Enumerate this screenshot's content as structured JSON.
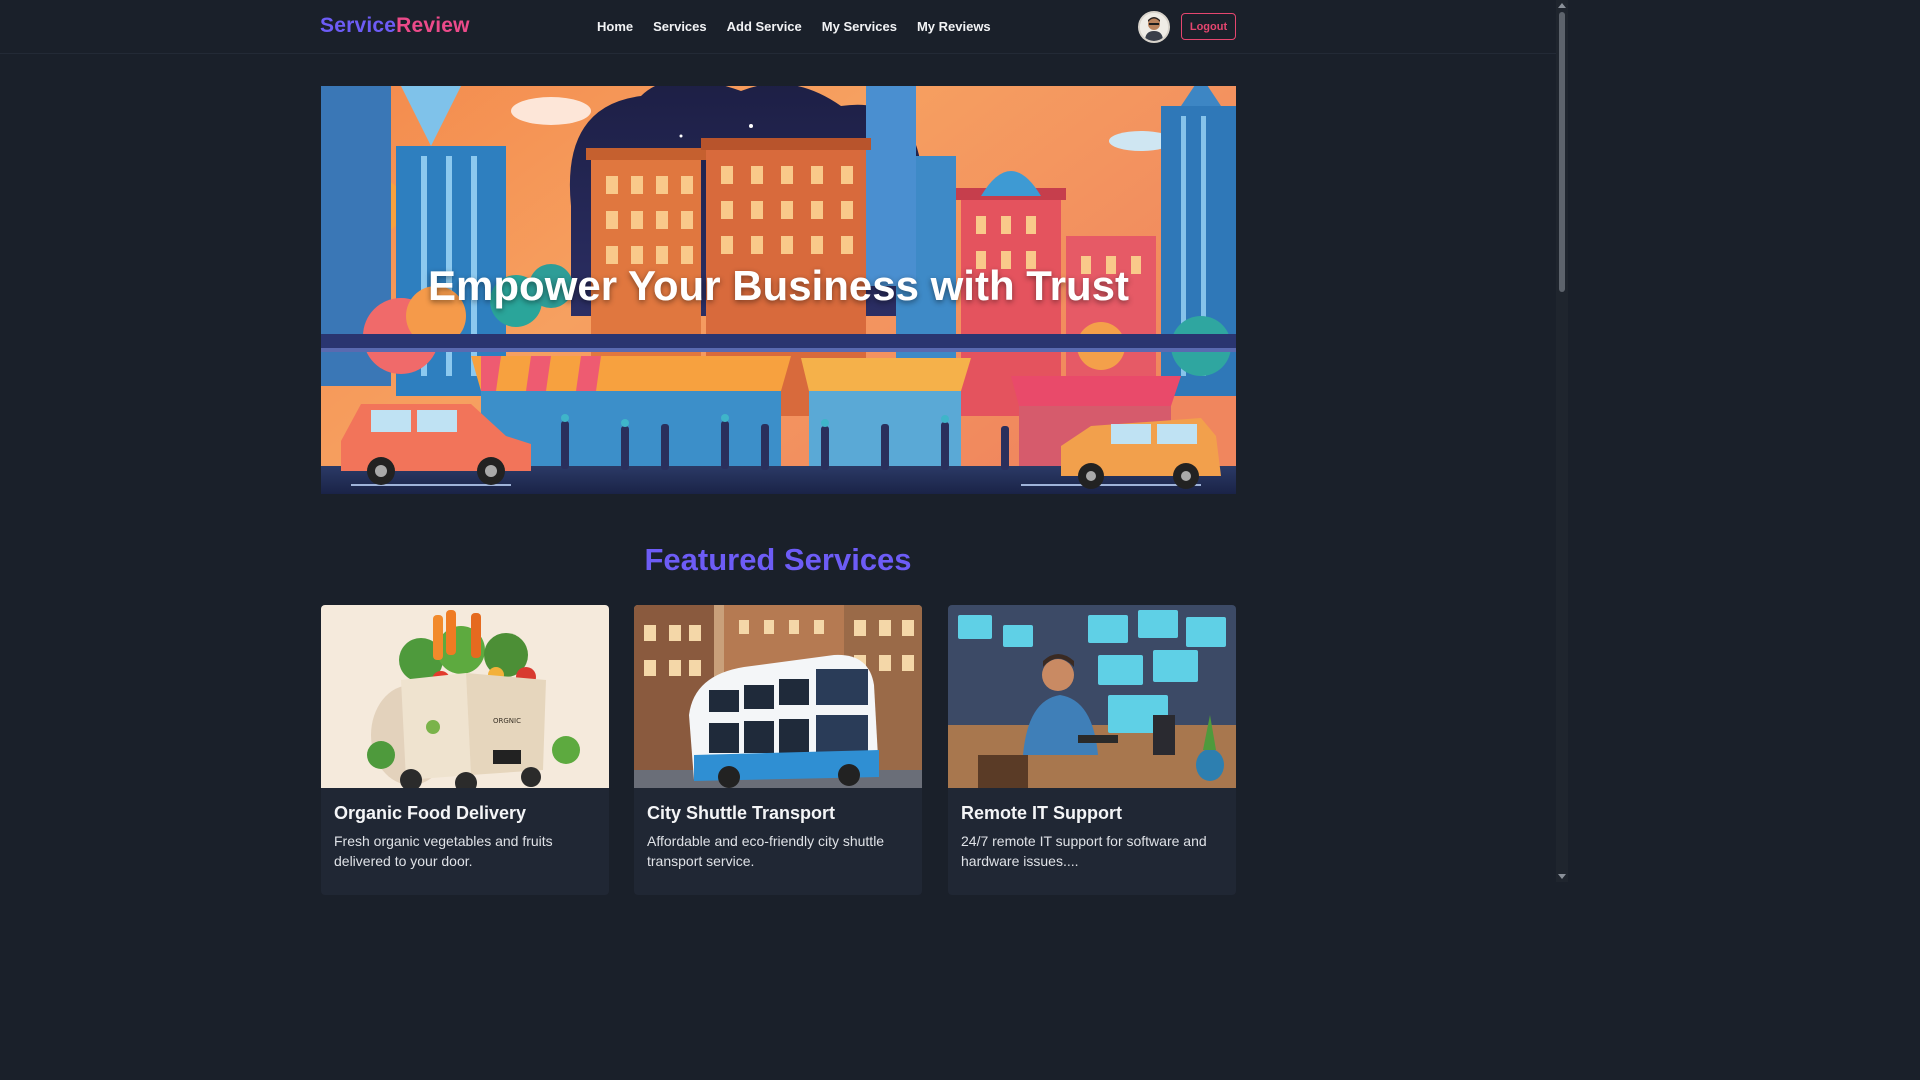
{
  "brand": {
    "part1": "Service",
    "part2": "Review"
  },
  "nav": {
    "items": [
      {
        "label": "Home"
      },
      {
        "label": "Services"
      },
      {
        "label": "Add Service"
      },
      {
        "label": "My Services"
      },
      {
        "label": "My Reviews"
      }
    ],
    "logout_label": "Logout"
  },
  "hero": {
    "title": "Empower Your Business with Trust"
  },
  "featured": {
    "title": "Featured Services",
    "cards": [
      {
        "title": "Organic Food Delivery",
        "description": "Fresh organic vegetables and fruits delivered to your door."
      },
      {
        "title": "City Shuttle Transport",
        "description": "Affordable and eco-friendly city shuttle transport service."
      },
      {
        "title": "Remote IT Support",
        "description": "24/7 remote IT support for software and hardware issues...."
      }
    ]
  },
  "colors": {
    "brand_primary": "#6d5cf6",
    "brand_accent": "#ec4a8a",
    "logout": "#e5466f",
    "background": "#1a202a",
    "card": "#202734"
  }
}
